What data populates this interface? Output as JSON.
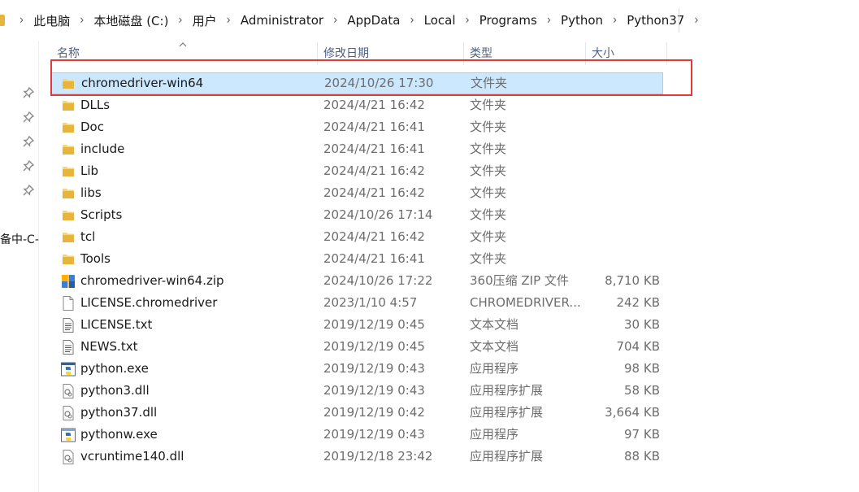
{
  "breadcrumb": [
    "此电脑",
    "本地磁盘 (C:)",
    "用户",
    "Administrator",
    "AppData",
    "Local",
    "Programs",
    "Python",
    "Python37"
  ],
  "columns": {
    "name": "名称",
    "date": "修改日期",
    "type": "类型",
    "size": "大小"
  },
  "sort_column": "name",
  "nav_fragment": "备中-C-",
  "selected_index": 0,
  "colors": {
    "selection_bg": "#cce8ff",
    "selection_border": "#99d1ff",
    "highlight_box": "#e03a3a",
    "folder": "#e8b53c"
  },
  "files": [
    {
      "name": "chromedriver-win64",
      "date": "2024/10/26 17:30",
      "type": "文件夹",
      "size": "",
      "icon": "folder-icon"
    },
    {
      "name": "DLLs",
      "date": "2024/4/21 16:42",
      "type": "文件夹",
      "size": "",
      "icon": "folder-icon"
    },
    {
      "name": "Doc",
      "date": "2024/4/21 16:41",
      "type": "文件夹",
      "size": "",
      "icon": "folder-icon"
    },
    {
      "name": "include",
      "date": "2024/4/21 16:41",
      "type": "文件夹",
      "size": "",
      "icon": "folder-icon"
    },
    {
      "name": "Lib",
      "date": "2024/4/21 16:42",
      "type": "文件夹",
      "size": "",
      "icon": "folder-icon"
    },
    {
      "name": "libs",
      "date": "2024/4/21 16:42",
      "type": "文件夹",
      "size": "",
      "icon": "folder-icon"
    },
    {
      "name": "Scripts",
      "date": "2024/10/26 17:14",
      "type": "文件夹",
      "size": "",
      "icon": "folder-icon"
    },
    {
      "name": "tcl",
      "date": "2024/4/21 16:42",
      "type": "文件夹",
      "size": "",
      "icon": "folder-icon"
    },
    {
      "name": "Tools",
      "date": "2024/4/21 16:41",
      "type": "文件夹",
      "size": "",
      "icon": "folder-icon"
    },
    {
      "name": "chromedriver-win64.zip",
      "date": "2024/10/26 17:22",
      "type": "360压缩 ZIP 文件",
      "size": "8,710 KB",
      "icon": "zip-archive-icon"
    },
    {
      "name": "LICENSE.chromedriver",
      "date": "2023/1/10 4:57",
      "type": "CHROMEDRIVER...",
      "size": "242 KB",
      "icon": "blank-file-icon"
    },
    {
      "name": "LICENSE.txt",
      "date": "2019/12/19 0:45",
      "type": "文本文档",
      "size": "30 KB",
      "icon": "text-file-icon"
    },
    {
      "name": "NEWS.txt",
      "date": "2019/12/19 0:45",
      "type": "文本文档",
      "size": "704 KB",
      "icon": "text-file-icon"
    },
    {
      "name": "python.exe",
      "date": "2019/12/19 0:43",
      "type": "应用程序",
      "size": "98 KB",
      "icon": "python-exe-icon"
    },
    {
      "name": "python3.dll",
      "date": "2019/12/19 0:43",
      "type": "应用程序扩展",
      "size": "58 KB",
      "icon": "dll-file-icon"
    },
    {
      "name": "python37.dll",
      "date": "2019/12/19 0:42",
      "type": "应用程序扩展",
      "size": "3,664 KB",
      "icon": "dll-file-icon"
    },
    {
      "name": "pythonw.exe",
      "date": "2019/12/19 0:43",
      "type": "应用程序",
      "size": "97 KB",
      "icon": "pythonw-exe-icon"
    },
    {
      "name": "vcruntime140.dll",
      "date": "2019/12/18 23:42",
      "type": "应用程序扩展",
      "size": "88 KB",
      "icon": "dll-file-icon"
    }
  ]
}
